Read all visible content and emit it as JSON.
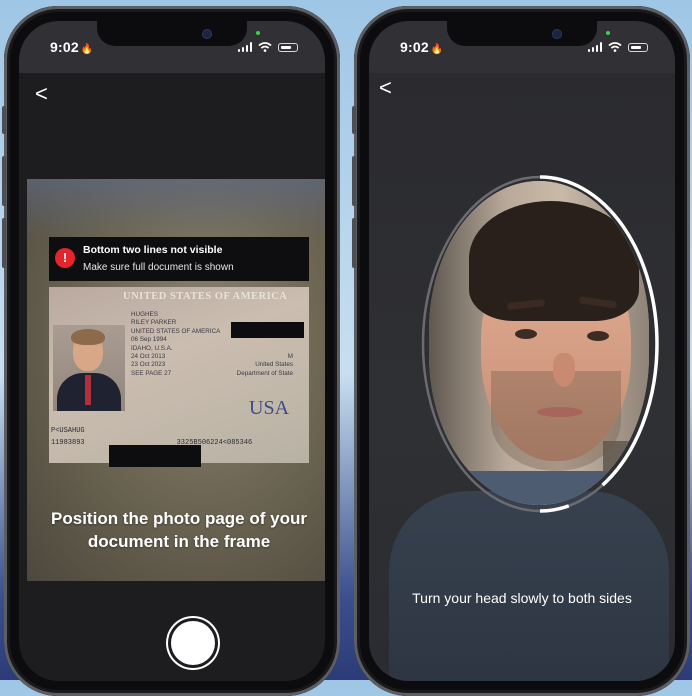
{
  "phones": [
    {
      "status": {
        "time": "9:02"
      },
      "back_label": "<",
      "alert": {
        "title": "Bottom two lines not visible",
        "message": "Make sure full document is shown",
        "icon": "alert-circle-icon",
        "color": "#e4252c"
      },
      "passport": {
        "header": "UNITED STATES OF AMERICA",
        "fields": [
          "HUGHES",
          "RILEY PARKER",
          "UNITED STATES OF AMERICA",
          "06 Sep 1994",
          "IDAHO, U.S.A.",
          "24 Oct 2013",
          "23 Oct 2023",
          "SEE PAGE 27"
        ],
        "fields_right": [
          "M",
          "United States",
          "Department of State"
        ],
        "country_mark": "USA",
        "mrz_line1": "P<USAHUG",
        "mrz_line2": "11983893",
        "mrz_line2_end": "3325B506224<085346"
      },
      "instruction": "Position the photo page of your document in the frame",
      "shutter_icon": "shutter-button-icon"
    },
    {
      "status": {
        "time": "9:02"
      },
      "back_label": "<",
      "instruction": "Turn your head slowly to both sides"
    }
  ]
}
